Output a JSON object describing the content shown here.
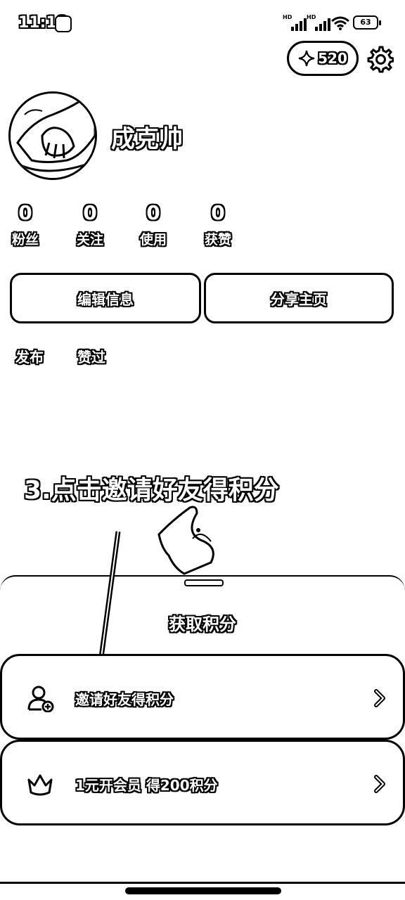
{
  "status_bar": {
    "time": "11:19",
    "battery": "63",
    "network_label": "HD",
    "icons": [
      "dingtalk-icon",
      "signal-icon",
      "signal-icon",
      "wifi-icon",
      "battery-icon"
    ]
  },
  "header": {
    "points": "520",
    "points_icon": "sparkle-icon",
    "settings_icon": "gear-icon"
  },
  "profile": {
    "username": "成克帅",
    "avatar_icon": "avatar-hands-image"
  },
  "stats": [
    {
      "value": "0",
      "label": "粉丝"
    },
    {
      "value": "0",
      "label": "关注"
    },
    {
      "value": "0",
      "label": "使用"
    },
    {
      "value": "0",
      "label": "获赞"
    }
  ],
  "buttons": {
    "edit_info": "编辑信息",
    "share_home": "分享主页"
  },
  "tabs": [
    "发布",
    "赞过"
  ],
  "annotation": {
    "instruction": "3.点击邀请好友得积分"
  },
  "sheet": {
    "title": "获取积分",
    "options": [
      {
        "label": "邀请好友得积分",
        "icon": "add-user-icon"
      },
      {
        "label": "1元开会员 得200积分",
        "icon": "crown-icon"
      }
    ]
  },
  "colors": {
    "background": "#ffffff",
    "foreground": "#000000"
  }
}
